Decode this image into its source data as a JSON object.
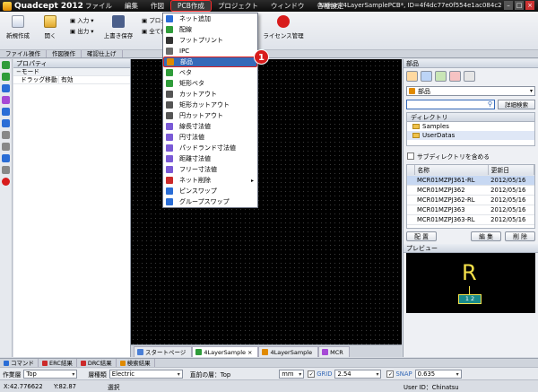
{
  "app": {
    "title": "Quadcept 2012",
    "window_title": "Name=4LayerSamplePCB*, ID=4f4dc77e0f554e1ac084c226, Nod…"
  },
  "menubar": [
    "ファイル",
    "編集",
    "作図",
    "PCB作成",
    "プロジェクト",
    "ウィンドウ",
    "各種設定"
  ],
  "ribbon": {
    "new": "新規作成",
    "open": "開く",
    "input": "入力",
    "output": "出力",
    "save_as": "上書き保存",
    "project": "プロジ",
    "save_all": "全て保",
    "license": "ライセンス管理"
  },
  "ribbon_tabs": [
    "ファイル操作",
    "作図操作",
    "確認仕上げ"
  ],
  "dropdown": {
    "items": [
      {
        "label": "ネット追加",
        "icon": "net-add-icon",
        "color": "#2a6dd6"
      },
      {
        "label": "配線",
        "icon": "wiring-icon",
        "color": "#2f9c3a"
      },
      {
        "label": "フットプリント",
        "icon": "footprint-icon",
        "color": "#333333"
      },
      {
        "label": "IPC",
        "icon": "ipc-icon",
        "color": "#6a6a6a"
      },
      {
        "label": "部品",
        "icon": "part-icon",
        "color": "#e08a00",
        "selected": true
      },
      {
        "label": "ベタ",
        "icon": "fill-icon",
        "color": "#2f9c3a"
      },
      {
        "label": "矩形ベタ",
        "icon": "rect-fill-icon",
        "color": "#2f9c3a"
      },
      {
        "label": "カットアウト",
        "icon": "cutout-icon",
        "color": "#555555"
      },
      {
        "label": "矩形カットアウト",
        "icon": "rect-cutout-icon",
        "color": "#555555"
      },
      {
        "label": "円カットアウト",
        "icon": "circle-cutout-icon",
        "color": "#555555"
      },
      {
        "label": "線長寸法値",
        "icon": "length-dim-icon",
        "color": "#7a5ad6"
      },
      {
        "label": "円寸法値",
        "icon": "circle-dim-icon",
        "color": "#7a5ad6"
      },
      {
        "label": "パッドランド寸法値",
        "icon": "pad-dim-icon",
        "color": "#7a5ad6"
      },
      {
        "label": "距離寸法値",
        "icon": "distance-dim-icon",
        "color": "#7a5ad6"
      },
      {
        "label": "フリー寸法値",
        "icon": "free-dim-icon",
        "color": "#7a5ad6"
      },
      {
        "label": "ネット削除",
        "icon": "net-delete-icon",
        "color": "#cc2a2a",
        "submenu": true
      },
      {
        "label": "ピンスワップ",
        "icon": "pin-swap-icon",
        "color": "#2a6dd6"
      },
      {
        "label": "グループスワップ",
        "icon": "group-swap-icon",
        "color": "#2a6dd6"
      }
    ],
    "submenu_arrow": "▸"
  },
  "callout_number": "1",
  "properties": {
    "title": "プロパティ",
    "section": "モード",
    "rows": [
      {
        "key": "ドラッグ移動",
        "value": "有効"
      }
    ]
  },
  "document_tabs": [
    {
      "label": "スタートページ",
      "active": false
    },
    {
      "label": "4LayerSample",
      "active": true
    },
    {
      "label": "4LayerSample",
      "active": false
    },
    {
      "label": "MCR",
      "active": false
    }
  ],
  "parts_panel": {
    "title": "部品",
    "combo_value": "部品",
    "search_button": "詳細検索",
    "directory_title": "ディレクトリ",
    "directories": [
      "Samples",
      "UserDatas"
    ],
    "include_subdirs": "サブディレクトリを含める",
    "table": {
      "headers": [
        "名称",
        "更新日"
      ],
      "rows": [
        {
          "name": "MCR01MZPJ361-RL",
          "date": "2012/05/16"
        },
        {
          "name": "MCR01MZPJ362",
          "date": "2012/05/16"
        },
        {
          "name": "MCR01MZPJ362-RL",
          "date": "2012/05/16"
        },
        {
          "name": "MCR01MZPJ363",
          "date": "2012/05/16"
        },
        {
          "name": "MCR01MZPJ363-RL",
          "date": "2012/05/16"
        }
      ]
    },
    "buttons": {
      "place": "配 置",
      "edit": "編 集",
      "delete": "削 除"
    },
    "preview_title": "プレビュー",
    "preview_symbol": "R",
    "preview_pads": "1 2"
  },
  "bottom_tabs": [
    "コマンド",
    "ERC結果",
    "DRC結果",
    "検索結果"
  ],
  "status": {
    "layer_label": "作業層",
    "layer_value": "Top",
    "type_label": "層種類",
    "type_value": "Electric",
    "prev_label": "直前の層：Top",
    "unit": "mm",
    "grid_label": "GRID",
    "grid_value": "2.54",
    "snap_label": "SNAP",
    "snap_value": "0.635"
  },
  "coords": {
    "x": "X:42.776622",
    "y": "Y:82.87",
    "mode": "選択",
    "user": "User ID：Chinatsu"
  }
}
